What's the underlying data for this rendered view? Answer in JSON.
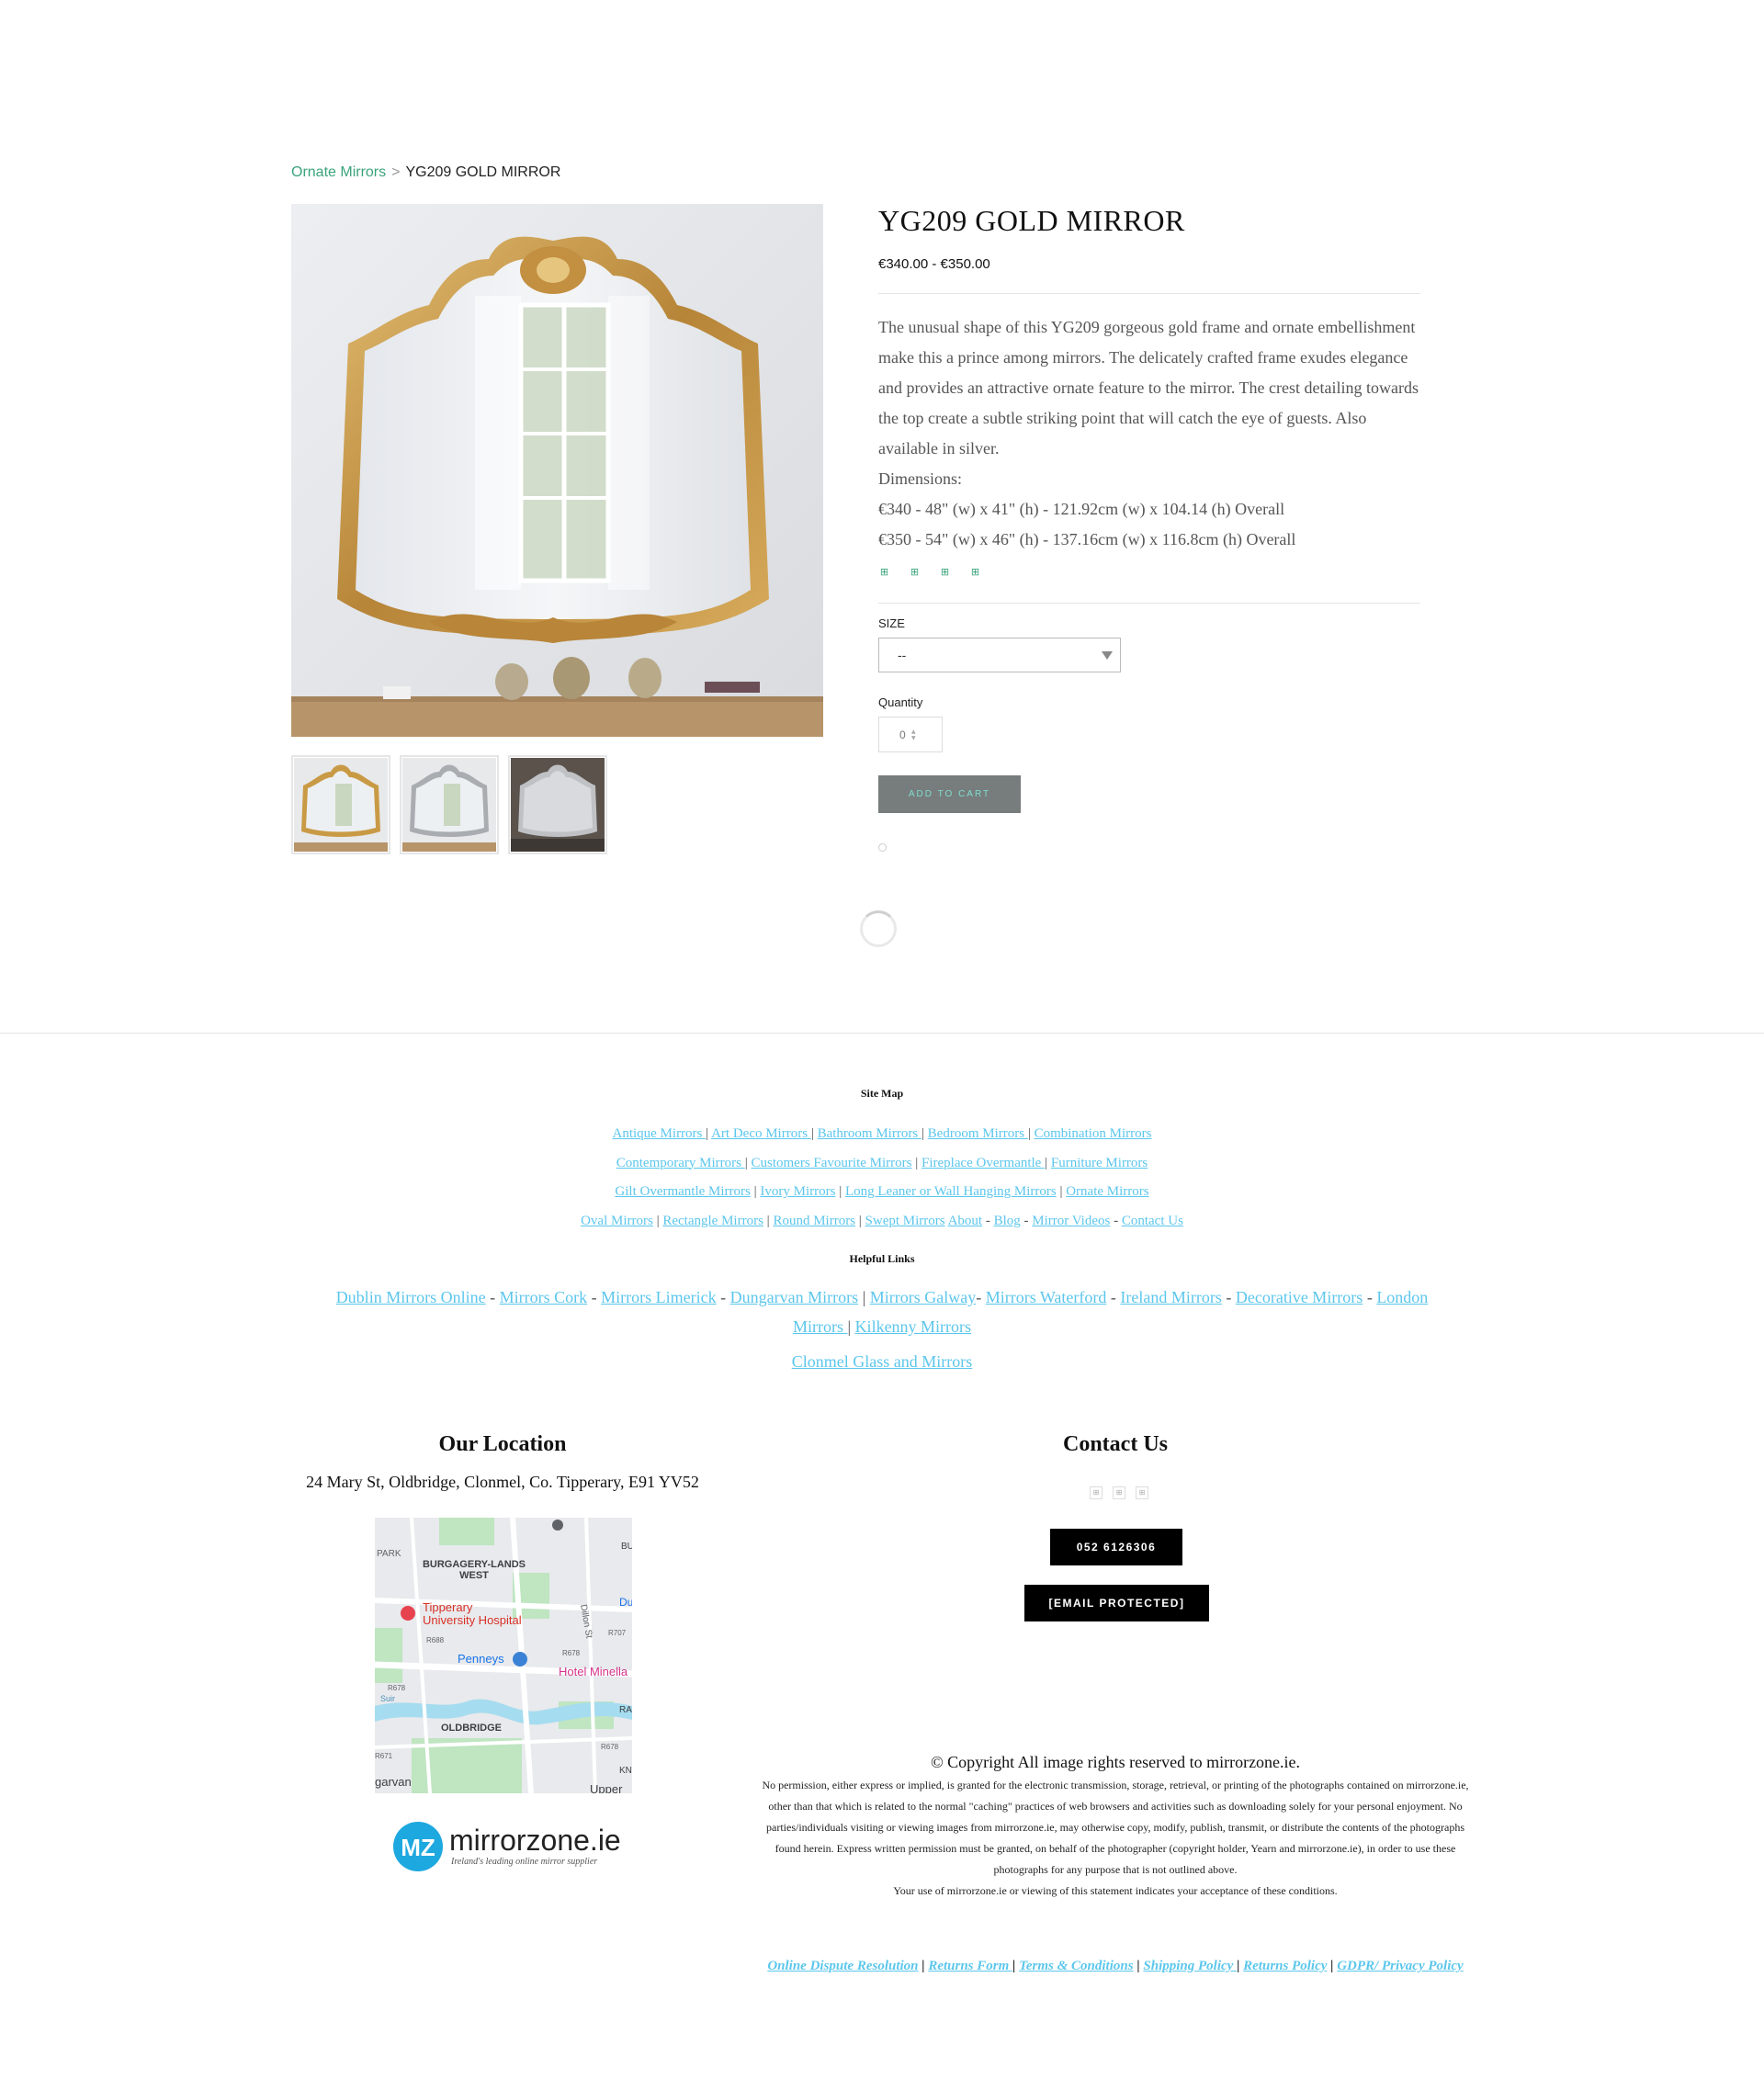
{
  "breadcrumb": {
    "parent": "Ornate Mirrors",
    "separator": ">",
    "current": "YG209 GOLD MIRROR"
  },
  "product": {
    "title": "YG209 GOLD MIRROR",
    "price": "€340.00 - €350.00",
    "description": "The unusual shape of this YG209 gorgeous gold frame and ornate embellishment make this a prince among mirrors. The delicately crafted frame exudes elegance and provides an attractive ornate feature to the mirror. The crest detailing towards the top create a subtle striking point that will catch the eye of guests. Also available in silver.",
    "dimensions_label": "Dimensions:",
    "dimension_1": "€340 - 48\" (w) x 41\" (h) - 121.92cm (w) x 104.14 (h) Overall",
    "dimension_2": "€350 - 54\" (w) x 46\" (h) - 137.16cm (w) x 116.8cm (h) Overall",
    "share_icons": [
      "facebook-icon",
      "twitter-icon",
      "pinterest-icon",
      "mail-icon"
    ],
    "size_label": "SIZE",
    "size_selected": "--",
    "quantity_label": "Quantity",
    "quantity_value": "0",
    "add_to_cart": "ADD TO CART"
  },
  "gallery": {
    "thumbnails": [
      "gold",
      "silver",
      "silver-dark"
    ]
  },
  "footer": {
    "site_map_heading": "Site Map",
    "site_map_lines": [
      [
        {
          "text": "Antique Mirrors "
        },
        {
          "sep": " | "
        },
        {
          "text": "Art Deco Mirrors "
        },
        {
          "sep": " | "
        },
        {
          "text": "Bathroom Mirrors "
        },
        {
          "sep": " | "
        },
        {
          "text": "Bedroom Mirrors "
        },
        {
          "sep": " | "
        },
        {
          "text": "Combination Mirrors"
        }
      ],
      [
        {
          "text": "Contemporary Mirrors "
        },
        {
          "sep": " | "
        },
        {
          "text": "Customers Favourite Mirrors"
        },
        {
          "sep": " | "
        },
        {
          "text": "Fireplace Overmantle "
        },
        {
          "sep": " | "
        },
        {
          "text": "Furniture Mirrors"
        }
      ],
      [
        {
          "text": "Gilt Overmantle Mirrors"
        },
        {
          "sep": " | "
        },
        {
          "text": "Ivory Mirrors"
        },
        {
          "sep": " | "
        },
        {
          "text": "Long Leaner or Wall Hanging Mirrors"
        },
        {
          "sep": " | "
        },
        {
          "text": "Ornate Mirrors"
        }
      ],
      [
        {
          "text": "Oval Mirrors"
        },
        {
          "sep": " | "
        },
        {
          "text": "Rectangle Mirrors"
        },
        {
          "sep": " | "
        },
        {
          "text": "Round Mirrors"
        },
        {
          "sep": " | "
        },
        {
          "text": "Swept Mirrors"
        },
        {
          "sep": " "
        },
        {
          "text": "About"
        },
        {
          "sep": " - "
        },
        {
          "text": "Blog"
        },
        {
          "sep": " - "
        },
        {
          "text": "Mirror Videos"
        },
        {
          "sep": " - "
        },
        {
          "text": "Contact Us"
        }
      ]
    ],
    "helpful_heading": "Helpful Links",
    "helpful_lines": [
      [
        {
          "text": "Dublin Mirrors Online"
        },
        {
          "sep": " - "
        },
        {
          "text": "Mirrors Cork"
        },
        {
          "sep": " - "
        },
        {
          "text": "Mirrors Limerick"
        },
        {
          "sep": " - "
        },
        {
          "text": "Dungarvan Mirrors"
        },
        {
          "sep": " | "
        },
        {
          "text": "Mirrors Galway"
        },
        {
          "sep": "- "
        },
        {
          "text": "Mirrors Waterford"
        },
        {
          "sep": " - "
        },
        {
          "text": "Ireland Mirrors"
        },
        {
          "sep": " - "
        },
        {
          "text": "Decorative Mirrors"
        },
        {
          "sep": " - "
        },
        {
          "text": "London"
        }
      ],
      [
        {
          "text": "Mirrors "
        },
        {
          "sep": " | "
        },
        {
          "text": "Kilkenny Mirrors"
        }
      ],
      [],
      [
        {
          "text": "Clonmel Glass and Mirrors"
        }
      ]
    ],
    "location_heading": "Our Location",
    "address": "24 Mary St, Oldbridge, Clonmel, Co. Tipperary, E91 YV52",
    "map": {
      "labels": {
        "park": "PARK",
        "burgagery_1": "BURGAGERY-LANDS",
        "burgagery_2": "WEST",
        "hospital_1": "Tipperary",
        "hospital_2": "University Hospital",
        "dillon": "Dillon St",
        "penneys": "Penneys",
        "hotel": "Hotel Minella",
        "oldbridge": "OLDBRIDGE",
        "garvan": "garvan",
        "upper": "Upper",
        "suir": "Suir",
        "bu": "BU",
        "du": "Du",
        "ra": "RA",
        "kn": "KN",
        "r688": "R688",
        "r678a": "R678",
        "r678b": "R678",
        "r678c": "R678",
        "r707": "R707",
        "r671": "R671"
      },
      "colors": {
        "land": "#e8eaed",
        "park": "#bfe5c1",
        "water": "#a6dcef",
        "road": "#ffffff",
        "hospital": "#e6434f",
        "shop": "#3b82d6",
        "hotel": "#d6338a"
      }
    },
    "logo": {
      "monogram": "MZ",
      "name": "mirrorzone.ie",
      "tagline": "Ireland's leading online mirror supplier",
      "color": "#1da8e0"
    },
    "contact_heading": "Contact Us",
    "contact_icons": [
      "facebook-icon",
      "twitter-icon",
      "pinterest-icon"
    ],
    "phone": "052 6126306",
    "email": "[EMAIL PROTECTED]",
    "copyright_title": "© Copyright All image rights reserved to mirrorzone.ie.",
    "copyright_body": "No permission, either express or implied, is granted for the electronic transmission, storage, retrieval, or printing of the photographs contained on mirrorzone.ie, other than that which is related to the normal \"caching\" practices of web browsers and activities such as downloading solely for your personal enjoyment. No parties/individuals visiting or viewing images from mirrorzone.ie, may otherwise copy, modify, publish, transmit, or distribute the contents of the photographs found herein. Express written permission must be granted, on behalf of the photographer (copyright holder, Yearn and mirrorzone.ie), in order to use these photographs for any purpose that is not outlined above.",
    "copyright_note": "Your use of mirrorzone.ie or viewing of this statement indicates your acceptance of these conditions.",
    "policy_links": [
      {
        "text": "Online Dispute Resolution"
      },
      {
        "sep": " | "
      },
      {
        "text": "Returns Form "
      },
      {
        "sep": " | "
      },
      {
        "text": "Terms & Conditions"
      },
      {
        "sep": " | "
      },
      {
        "text": "Shipping Policy "
      },
      {
        "sep": " | "
      },
      {
        "text": "Returns Policy"
      },
      {
        "sep": " | "
      },
      {
        "text": "GDPR/ Privacy Policy"
      }
    ]
  },
  "colors": {
    "accent_green": "#3aa37c",
    "link_blue": "#5bc6ec",
    "gold_frame": "#c99a45",
    "button_grey": "#777d7c"
  }
}
